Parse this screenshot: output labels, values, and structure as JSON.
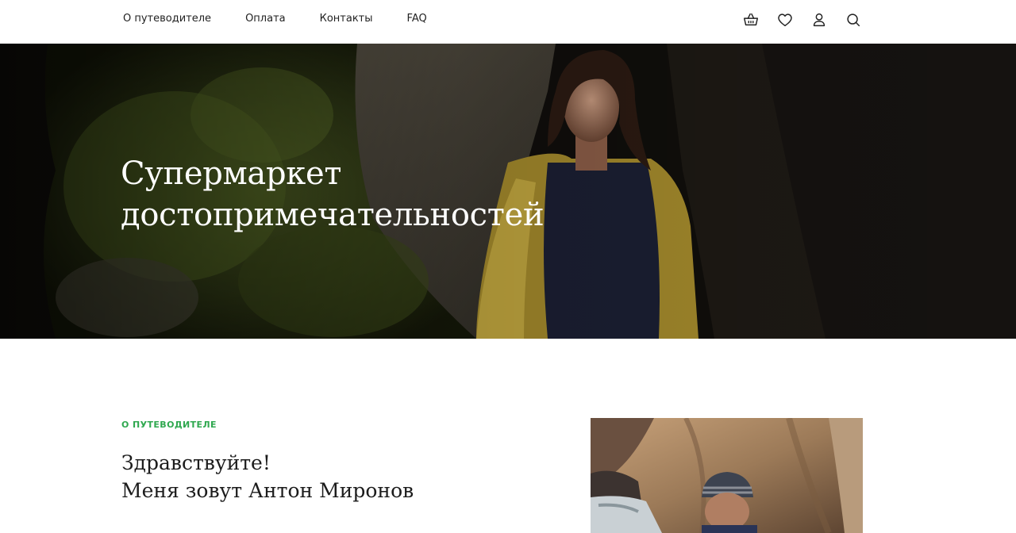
{
  "nav": {
    "items": [
      {
        "label": "О путеводителе"
      },
      {
        "label": "Оплата"
      },
      {
        "label": "Контакты"
      },
      {
        "label": "FAQ"
      }
    ]
  },
  "header_icons": [
    "basket-icon",
    "heart-icon",
    "user-icon",
    "search-icon"
  ],
  "hero": {
    "title_line1": "Супермаркет",
    "title_line2": "достопримечательностей"
  },
  "about": {
    "tag": "О ПУТЕВОДИТЕЛЕ",
    "greeting_line1": "Здравствуйте!",
    "greeting_line2": "Меня зовут Антон Миронов"
  },
  "colors": {
    "accent_green": "#2fa84f",
    "text_dark": "#1c1c1c",
    "background": "#ffffff"
  }
}
